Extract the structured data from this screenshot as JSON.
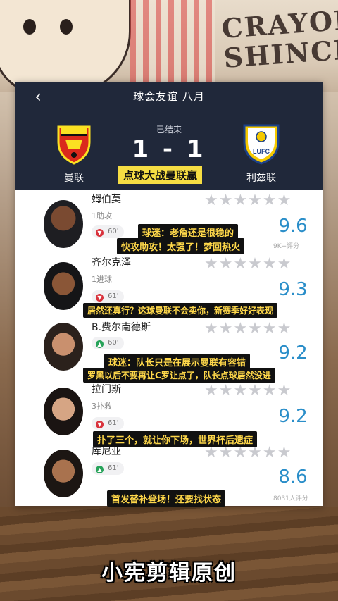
{
  "background": {
    "brand_text": "CRAYON SHINCHAN"
  },
  "header": {
    "title": "球会友谊 八月",
    "back_icon": "chevron-left-icon",
    "status": "已结束",
    "score": "1 - 1",
    "home_team": "曼联",
    "away_team": "利兹联",
    "home_crest": {
      "top_text": "MANCHESTER",
      "bottom_text": "UNITED"
    },
    "away_crest": {
      "text": "LUFC"
    },
    "caption": "点球大战曼联赢"
  },
  "players": [
    {
      "name": "姆伯莫",
      "stat": "1助攻",
      "minute": "60'",
      "event": "down",
      "rating": "9.6",
      "rating_count": "9K+评分",
      "captions": [
        "球迷：老詹还是很稳的",
        "快攻助攻！太强了！梦回热火"
      ]
    },
    {
      "name": "齐尔克泽",
      "stat": "1进球",
      "minute": "61'",
      "event": "down",
      "rating": "9.3",
      "rating_count": "",
      "captions": [
        "居然还真行？这球曼联不会卖你，新赛季好好表现"
      ]
    },
    {
      "name": "B.费尔南德斯",
      "stat": "",
      "minute": "60'",
      "event": "up",
      "rating": "9.2",
      "rating_count": "",
      "captions": [
        "球迷：队长只是在展示曼联有容错",
        "罗黑以后不要再让C罗让点了，队长点球居然没进"
      ]
    },
    {
      "name": "拉门斯",
      "stat": "3扑救",
      "minute": "61'",
      "event": "down",
      "rating": "9.2",
      "rating_count": "",
      "captions": [
        "扑了三个，就让你下场，世界杯后遗症"
      ]
    },
    {
      "name": "库尼亚",
      "stat": "",
      "minute": "61'",
      "event": "up",
      "rating": "8.6",
      "rating_count": "8031人评分",
      "captions": [
        "首发替补登场！还要找状态"
      ]
    }
  ],
  "watermark": "小宪剪辑原创"
}
